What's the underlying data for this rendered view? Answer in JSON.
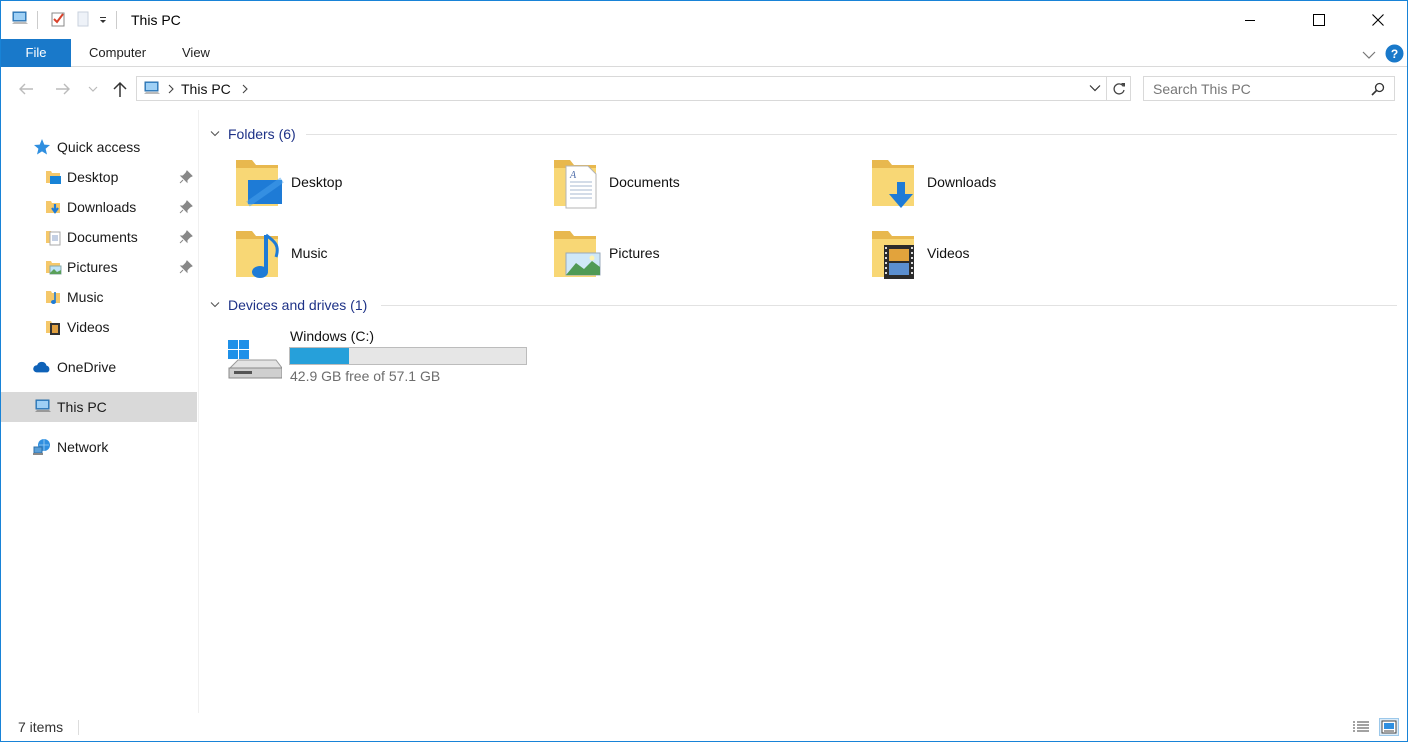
{
  "window": {
    "title": "This PC",
    "accent": "#1979ca",
    "controls": {
      "minimize": "minimize-icon",
      "maximize": "maximize-icon",
      "close": "close-icon"
    }
  },
  "ribbon": {
    "tabs": [
      {
        "label": "File"
      },
      {
        "label": "Computer"
      },
      {
        "label": "View"
      }
    ]
  },
  "address": {
    "path": [
      "This PC"
    ],
    "search_placeholder": "Search This PC"
  },
  "sidebar": {
    "items": [
      {
        "label": "Quick access",
        "icon": "star-icon"
      },
      {
        "label": "Desktop",
        "icon": "desktop-folder-icon",
        "pinned": true
      },
      {
        "label": "Downloads",
        "icon": "downloads-folder-icon",
        "pinned": true
      },
      {
        "label": "Documents",
        "icon": "documents-folder-icon",
        "pinned": true
      },
      {
        "label": "Pictures",
        "icon": "pictures-folder-icon",
        "pinned": true
      },
      {
        "label": "Music",
        "icon": "music-folder-icon"
      },
      {
        "label": "Videos",
        "icon": "videos-folder-icon"
      },
      {
        "label": "OneDrive",
        "icon": "cloud-icon"
      },
      {
        "label": "This PC",
        "icon": "computer-icon",
        "selected": true
      },
      {
        "label": "Network",
        "icon": "network-icon"
      }
    ]
  },
  "content": {
    "folders_header": "Folders (6)",
    "folders": [
      {
        "name": "Desktop",
        "icon": "desktop-folder-icon"
      },
      {
        "name": "Documents",
        "icon": "documents-folder-icon"
      },
      {
        "name": "Downloads",
        "icon": "downloads-folder-icon"
      },
      {
        "name": "Music",
        "icon": "music-folder-icon"
      },
      {
        "name": "Pictures",
        "icon": "pictures-folder-icon"
      },
      {
        "name": "Videos",
        "icon": "videos-folder-icon"
      }
    ],
    "devices_header": "Devices and drives (1)",
    "drives": [
      {
        "name": "Windows (C:)",
        "free_text": "42.9 GB free of 57.1 GB",
        "used_fraction": 0.249,
        "bar_color": "#26a0da"
      }
    ]
  },
  "status": {
    "item_count": "7 items"
  }
}
